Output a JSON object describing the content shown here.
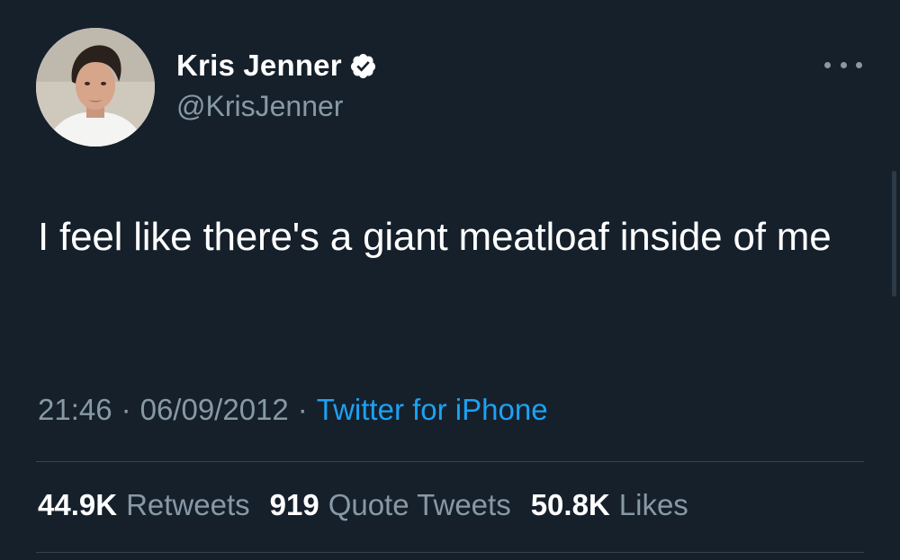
{
  "author": {
    "display_name": "Kris Jenner",
    "handle": "@KrisJenner",
    "verified": true,
    "avatar": "avatar-photo"
  },
  "tweet": {
    "text": "I feel like there's a giant meatloaf inside of me",
    "time": "21:46",
    "date": "06/09/2012",
    "source": "Twitter for iPhone",
    "separator": "·"
  },
  "stats": {
    "retweets": {
      "count": "44.9K",
      "label": "Retweets"
    },
    "quote_tweets": {
      "count": "919",
      "label": "Quote Tweets"
    },
    "likes": {
      "count": "50.8K",
      "label": "Likes"
    }
  },
  "icons": {
    "more": "more-horizontal-icon",
    "verified": "verified-badge-icon"
  },
  "colors": {
    "background": "#15202b",
    "text": "#ffffff",
    "secondary_text": "#8899a6",
    "link": "#1da1f2",
    "divider": "#38444d"
  }
}
